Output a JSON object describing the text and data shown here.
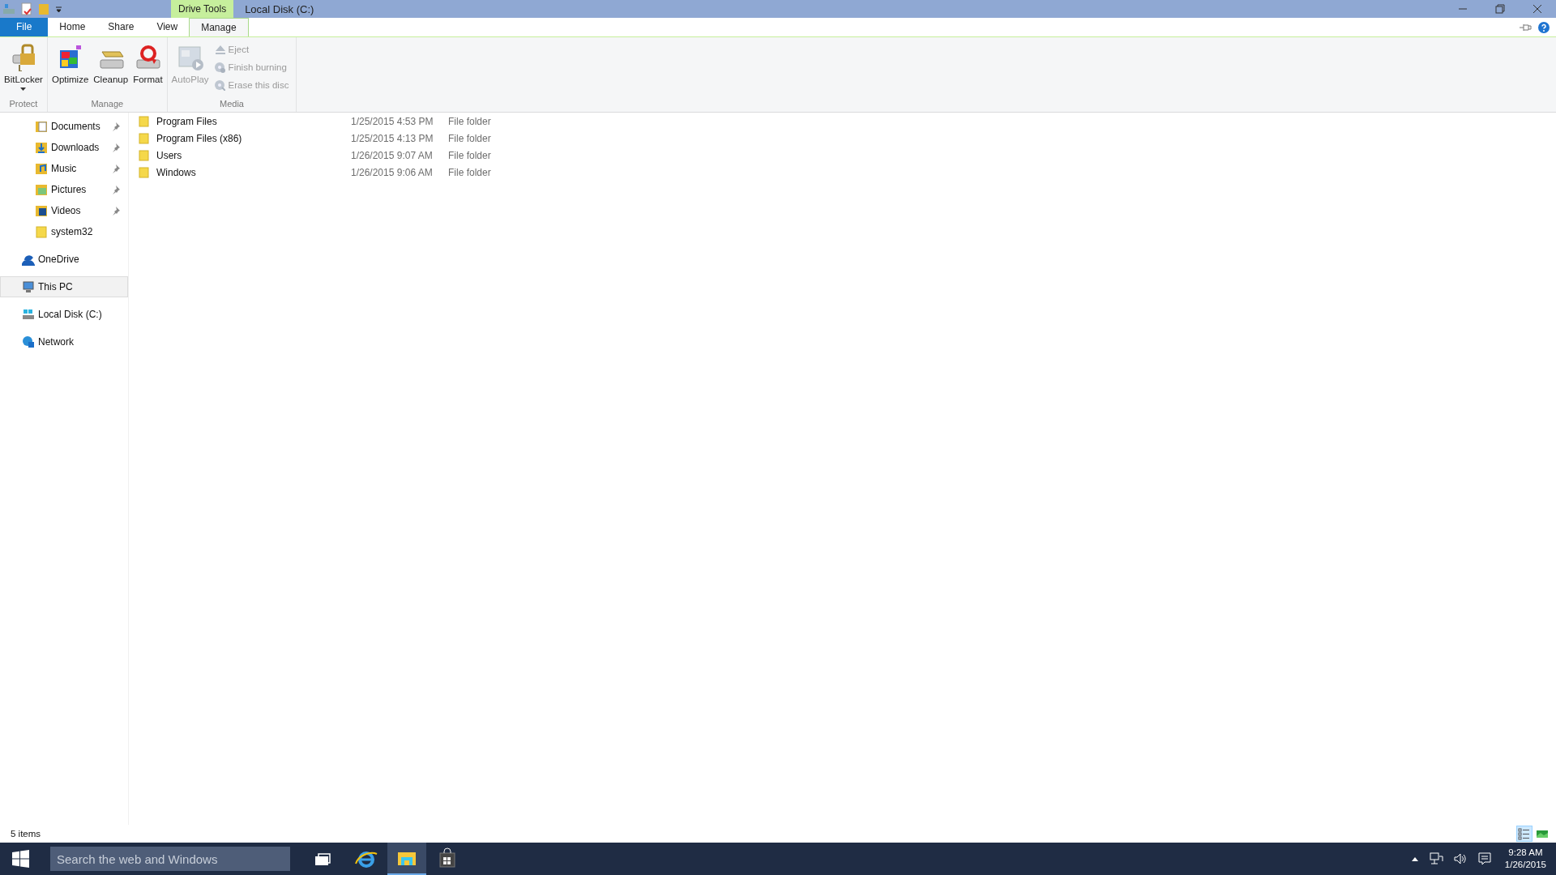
{
  "title_bar": {
    "context_tab": "Drive Tools",
    "title": "Local Disk (C:)"
  },
  "ribbon_tabs": [
    {
      "label": "File",
      "selected": false,
      "kind": "file"
    },
    {
      "label": "Home",
      "selected": false,
      "kind": "tab"
    },
    {
      "label": "Share",
      "selected": false,
      "kind": "tab"
    },
    {
      "label": "View",
      "selected": false,
      "kind": "tab"
    },
    {
      "label": "Manage",
      "selected": true,
      "kind": "context"
    }
  ],
  "ribbon_groups": [
    {
      "label": "Protect",
      "commands": [
        {
          "label": "BitLocker",
          "kind": "large",
          "disabled": false,
          "dropdown": true
        }
      ]
    },
    {
      "label": "Manage",
      "commands": [
        {
          "label": "Optimize",
          "kind": "large",
          "disabled": false,
          "dropdown": false
        },
        {
          "label": "Cleanup",
          "kind": "large",
          "disabled": false,
          "dropdown": false
        },
        {
          "label": "Format",
          "kind": "large",
          "disabled": false,
          "dropdown": false
        }
      ]
    },
    {
      "label": "Media",
      "commands": [
        {
          "label": "AutoPlay",
          "kind": "large",
          "disabled": true,
          "dropdown": false
        },
        {
          "label": "Eject",
          "kind": "small",
          "disabled": true
        },
        {
          "label": "Finish burning",
          "kind": "small",
          "disabled": true
        },
        {
          "label": "Erase this disc",
          "kind": "small",
          "disabled": true
        }
      ]
    }
  ],
  "navigation": {
    "quick_access": [
      {
        "label": "Documents",
        "pinned": true,
        "selected": false
      },
      {
        "label": "Downloads",
        "pinned": true,
        "selected": false
      },
      {
        "label": "Music",
        "pinned": true,
        "selected": false
      },
      {
        "label": "Pictures",
        "pinned": true,
        "selected": false
      },
      {
        "label": "Videos",
        "pinned": true,
        "selected": false
      },
      {
        "label": "system32",
        "pinned": false,
        "selected": false
      }
    ],
    "locations": [
      {
        "label": "OneDrive",
        "selected": false
      },
      {
        "label": "This PC",
        "selected": true
      },
      {
        "label": "Local Disk (C:)",
        "selected": false
      },
      {
        "label": "Network",
        "selected": false
      }
    ]
  },
  "files": [
    {
      "name": "Program Files",
      "date_modified": "1/25/2015 4:53 PM",
      "type": "File folder"
    },
    {
      "name": "Program Files (x86)",
      "date_modified": "1/25/2015 4:13 PM",
      "type": "File folder"
    },
    {
      "name": "Users",
      "date_modified": "1/26/2015 9:07 AM",
      "type": "File folder"
    },
    {
      "name": "Windows",
      "date_modified": "1/26/2015 9:06 AM",
      "type": "File folder"
    }
  ],
  "status_bar": {
    "item_count": "5 items",
    "views": [
      {
        "kind": "details",
        "selected": true
      },
      {
        "kind": "large_icons",
        "selected": false
      }
    ]
  },
  "taskbar": {
    "search": {
      "placeholder": "Search the web and Windows"
    },
    "apps": [
      {
        "kind": "task_view",
        "active": false
      },
      {
        "kind": "browser",
        "active": false
      },
      {
        "kind": "explorer",
        "active": true
      },
      {
        "kind": "store",
        "active": false
      }
    ],
    "clock": {
      "time": "9:28 AM",
      "date": "1/26/2015"
    }
  }
}
